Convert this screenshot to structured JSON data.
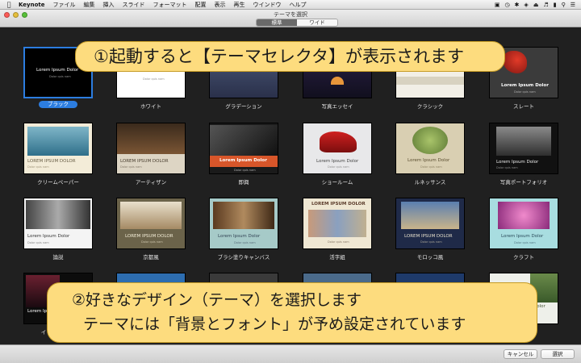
{
  "menubar": {
    "app_name": "Keynote",
    "items": [
      "ファイル",
      "編集",
      "挿入",
      "スライド",
      "フォーマット",
      "配置",
      "表示",
      "再生",
      "ウインドウ",
      "ヘルプ"
    ]
  },
  "window": {
    "title": "テーマを選択",
    "segments": [
      "標準",
      "ワイド"
    ],
    "active_segment": "標準"
  },
  "themes": [
    {
      "name": "ブラック",
      "thumb_title": "Lorem Ipsum Dolor",
      "thumb_sub": "Dolor quis nam",
      "selected": true
    },
    {
      "name": "ホワイト",
      "thumb_title": "",
      "thumb_sub": "Dolor quis nam"
    },
    {
      "name": "グラデーション",
      "thumb_title": "",
      "thumb_sub": ""
    },
    {
      "name": "写真エッセイ",
      "thumb_title": "",
      "thumb_sub": ""
    },
    {
      "name": "クラシック",
      "thumb_title": "",
      "thumb_sub": ""
    },
    {
      "name": "スレート",
      "thumb_title": "Lorem Ipsum Dolor",
      "thumb_sub": "Dolor quis nam"
    },
    {
      "name": "クリームペーパー",
      "thumb_title": "LOREM IPSUM DOLOR",
      "thumb_sub": "Dolor quis nam"
    },
    {
      "name": "アーティザン",
      "thumb_title": "LOREM IPSUM DOLOR",
      "thumb_sub": "Dolor quis nam"
    },
    {
      "name": "即興",
      "thumb_title": "Lorem Ipsum Dolor",
      "thumb_sub": "Dolor quis nam"
    },
    {
      "name": "ショールーム",
      "thumb_title": "Lorem Ipsum Dolor",
      "thumb_sub": "Dolor quis nam"
    },
    {
      "name": "ルネッサンス",
      "thumb_title": "Lorem Ipsum Dolor",
      "thumb_sub": "Dolor quis nam"
    },
    {
      "name": "写真ポートフォリオ",
      "thumb_title": "Lorem Ipsum Dolor",
      "thumb_sub": "Dolor quis nam"
    },
    {
      "name": "論説",
      "thumb_title": "Lorem Ipsum Dolor",
      "thumb_sub": "Dolor quis nam"
    },
    {
      "name": "京都風",
      "thumb_title": "LOREM IPSUM DOLOR",
      "thumb_sub": "Dolor quis nam"
    },
    {
      "name": "ブラシ塗りキャンバス",
      "thumb_title": "Lorem Ipsum Dolor",
      "thumb_sub": "Dolor quis nam"
    },
    {
      "name": "活字組",
      "thumb_title": "LOREM IPSUM DOLOR",
      "thumb_sub": "Dolor quis nam"
    },
    {
      "name": "モロッコ風",
      "thumb_title": "LOREM IPSUM DOLOR",
      "thumb_sub": "Dolor quis nam"
    },
    {
      "name": "クラフト",
      "thumb_title": "Lorem Ipsum Dolor",
      "thumb_sub": "Dolor quis nam"
    },
    {
      "name": "イ",
      "thumb_title": "Lorem Ipsum Dolor",
      "thumb_sub": ""
    },
    {
      "name": "",
      "thumb_title": "",
      "thumb_sub": ""
    },
    {
      "name": "",
      "thumb_title": "",
      "thumb_sub": ""
    },
    {
      "name": "",
      "thumb_title": "",
      "thumb_sub": ""
    },
    {
      "name": "",
      "thumb_title": "",
      "thumb_sub": ""
    },
    {
      "name": "",
      "thumb_title": "Dolor",
      "thumb_sub": ""
    }
  ],
  "buttons": {
    "cancel": "キャンセル",
    "choose": "選択"
  },
  "callouts": {
    "one": "①起動すると【テーマセレクタ】が表示されます",
    "two_line1": "②好きなデザイン（テーマ）を選択します",
    "two_line2": "テーマには「背景とフォント」が予め設定されています"
  },
  "colors": {
    "selection": "#2c7de0",
    "callout_fill": "#fddc7e",
    "background": "#202020"
  }
}
